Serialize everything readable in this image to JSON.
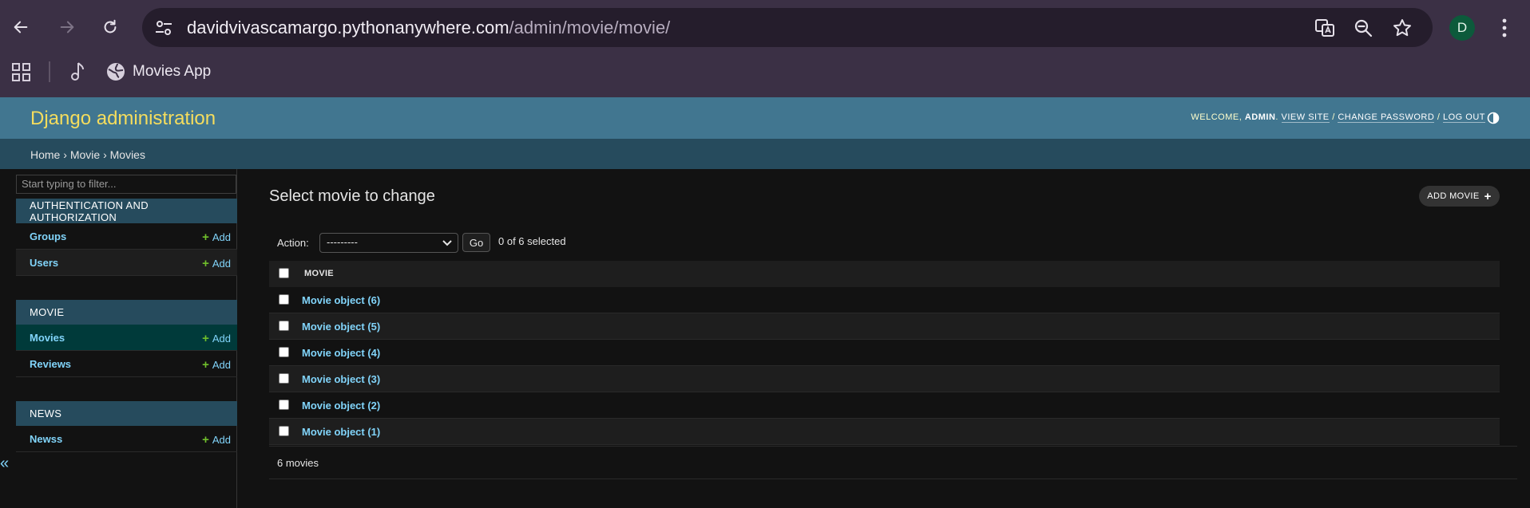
{
  "browser": {
    "url_host": "davidvivascamargo.pythonanywhere.com",
    "url_path": "/admin/movie/movie/",
    "profile_initial": "D",
    "bookmark_label": "Movies App"
  },
  "header": {
    "brand": "Django administration",
    "welcome": "Welcome,",
    "user": "admin",
    "view_site": "View site",
    "change_password": "Change password",
    "log_out": "Log out"
  },
  "breadcrumbs": {
    "home": "Home",
    "app": "Movie",
    "model": "Movies",
    "sep": "›"
  },
  "sidebar": {
    "filter_placeholder": "Start typing to filter...",
    "modules": [
      {
        "caption": "AUTHENTICATION AND AUTHORIZATION",
        "models": [
          {
            "name": "Groups",
            "add": "Add"
          },
          {
            "name": "Users",
            "add": "Add"
          }
        ]
      },
      {
        "caption": "MOVIE",
        "models": [
          {
            "name": "Movies",
            "add": "Add"
          },
          {
            "name": "Reviews",
            "add": "Add"
          }
        ]
      },
      {
        "caption": "NEWS",
        "models": [
          {
            "name": "Newss",
            "add": "Add"
          }
        ]
      }
    ],
    "collapse": "«"
  },
  "content": {
    "title": "Select movie to change",
    "add_button": "Add movie",
    "action_label": "Action:",
    "action_selected": "---------",
    "go": "Go",
    "selected_count": "0 of 6 selected",
    "column_header": "Movie",
    "rows": [
      "Movie object (6)",
      "Movie object (5)",
      "Movie object (4)",
      "Movie object (3)",
      "Movie object (2)",
      "Movie object (1)"
    ],
    "paginator": "6 movies"
  }
}
